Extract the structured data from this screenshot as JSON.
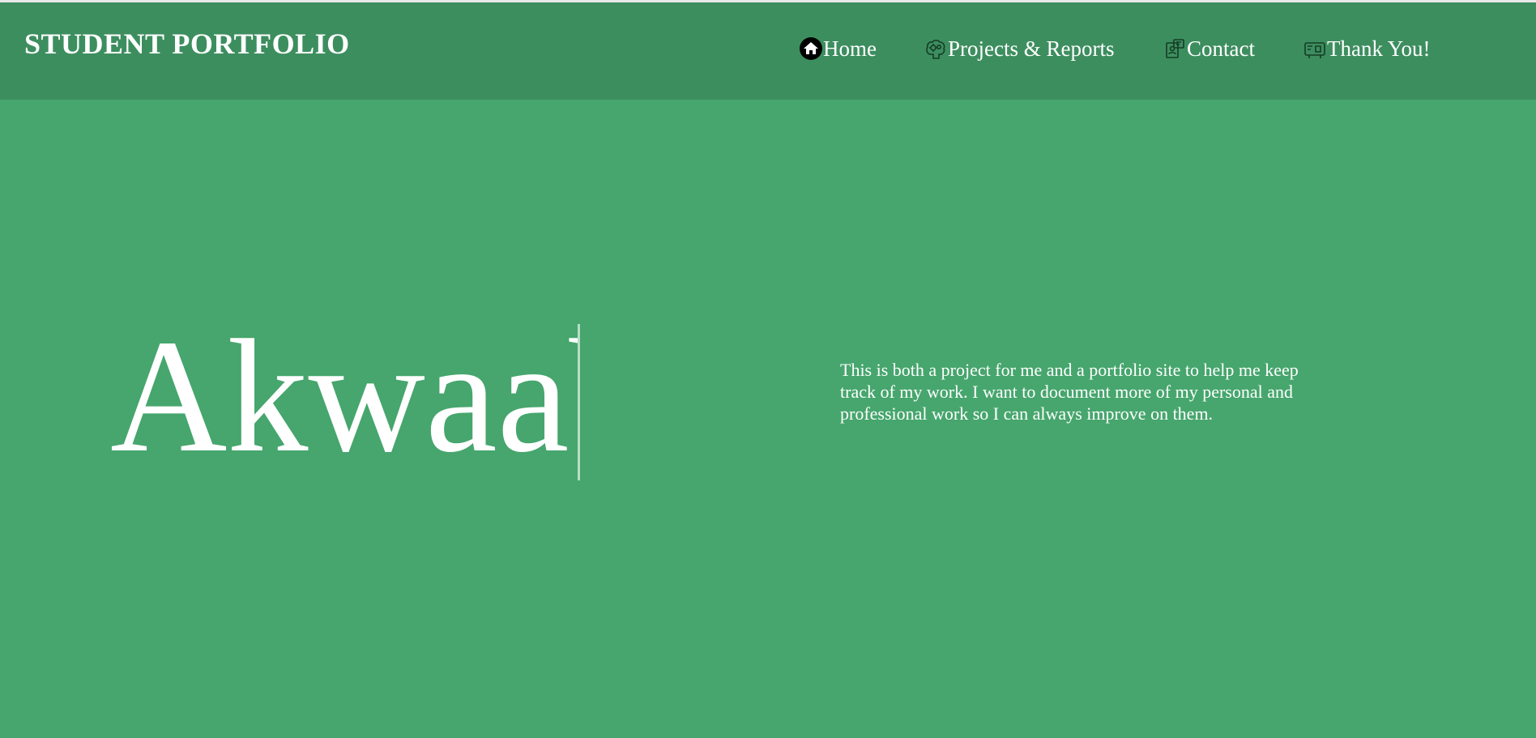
{
  "header": {
    "brand": "STUDENT PORTFOLIO",
    "nav": [
      {
        "label": "Home",
        "icon": "home-icon"
      },
      {
        "label": "Projects & Reports",
        "icon": "brain-gears-icon"
      },
      {
        "label": "Contact",
        "icon": "contact-card-icon"
      },
      {
        "label": "Thank You!",
        "icon": "thank-you-card-icon"
      }
    ]
  },
  "hero": {
    "typed_text": "Akwaab",
    "intro": "This is both a project for me and a portfolio site to help me keep track of my work. I want to document more of my personal and professional work so I can always improve on them."
  },
  "colors": {
    "background": "#46a66d",
    "header": "#3d8e5f",
    "text": "#ffffff"
  }
}
